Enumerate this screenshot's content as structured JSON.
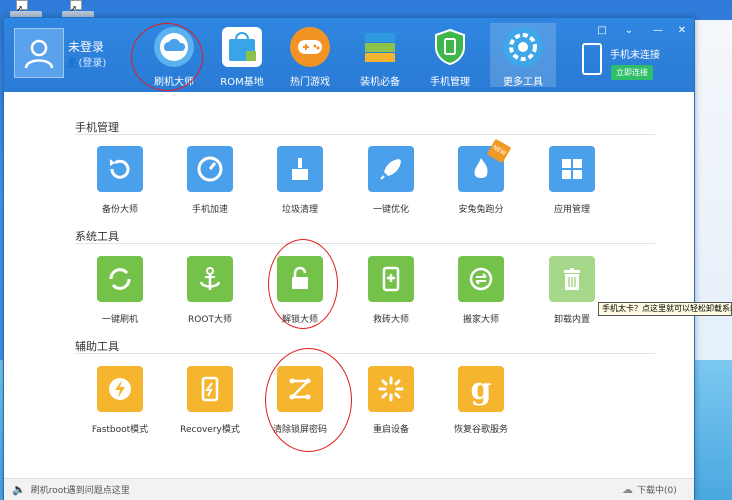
{
  "desktop": {
    "tooltip": "手机太卡？点这里就可以轻松卸载系统自带软件"
  },
  "header": {
    "user_title": "未登录",
    "user_sub": "(登录)",
    "tabs": [
      {
        "label": "刷机大师",
        "icon": "cloud-icon",
        "active": false
      },
      {
        "label": "ROM基地",
        "icon": "rom-bag-icon",
        "active": false
      },
      {
        "label": "热门游戏",
        "icon": "gamepad-icon",
        "active": false
      },
      {
        "label": "装机必备",
        "icon": "book-stack-icon",
        "active": false
      },
      {
        "label": "手机管理",
        "icon": "shield-phone-icon",
        "active": false
      },
      {
        "label": "更多工具",
        "icon": "gear-icon",
        "active": true
      }
    ],
    "phone_status": "手机未连接",
    "connect_label": "立即连接"
  },
  "sections": [
    {
      "title": "手机管理",
      "items": [
        {
          "label": "备份大师",
          "icon": "backup-icon",
          "color": "#4aa0ea"
        },
        {
          "label": "手机加速",
          "icon": "speedometer-icon",
          "color": "#4aa0ea"
        },
        {
          "label": "垃圾清理",
          "icon": "broom-icon",
          "color": "#4aa0ea"
        },
        {
          "label": "一键优化",
          "icon": "rocket-icon",
          "color": "#4aa0ea"
        },
        {
          "label": "安兔兔跑分",
          "icon": "flame-icon",
          "color": "#4aa0ea",
          "badge": "NEW"
        },
        {
          "label": "应用管理",
          "icon": "grid-apps-icon",
          "color": "#4aa0ea"
        }
      ]
    },
    {
      "title": "系统工具",
      "items": [
        {
          "label": "一键刷机",
          "icon": "refresh-icon",
          "color": "#74c24a"
        },
        {
          "label": "ROOT大师",
          "icon": "anchor-icon",
          "color": "#74c24a"
        },
        {
          "label": "解锁大师",
          "icon": "unlock-icon",
          "color": "#74c24a"
        },
        {
          "label": "救砖大师",
          "icon": "phone-plus-icon",
          "color": "#74c24a"
        },
        {
          "label": "搬家大师",
          "icon": "transfer-icon",
          "color": "#74c24a"
        },
        {
          "label": "卸载内置",
          "icon": "trash-icon",
          "color": "#a7d78a"
        }
      ]
    },
    {
      "title": "辅助工具",
      "items": [
        {
          "label": "Fastboot模式",
          "icon": "bolt-icon",
          "color": "#f5b52e"
        },
        {
          "label": "Recovery模式",
          "icon": "recovery-phone-icon",
          "color": "#f5b52e"
        },
        {
          "label": "清除锁屏密码",
          "icon": "pattern-lock-icon",
          "color": "#f5b52e"
        },
        {
          "label": "重启设备",
          "icon": "spinner-icon",
          "color": "#f5b52e"
        },
        {
          "label": "恢复谷歌服务",
          "icon": "google-g-icon",
          "color": "#f5b52e"
        }
      ]
    }
  ],
  "footer": {
    "left_text": "刷机root遇到问题点这里",
    "right_text": "下载中(0)"
  },
  "colors": {
    "header_blue": "#2a7bd5",
    "annotation_red": "#e01c1c"
  }
}
